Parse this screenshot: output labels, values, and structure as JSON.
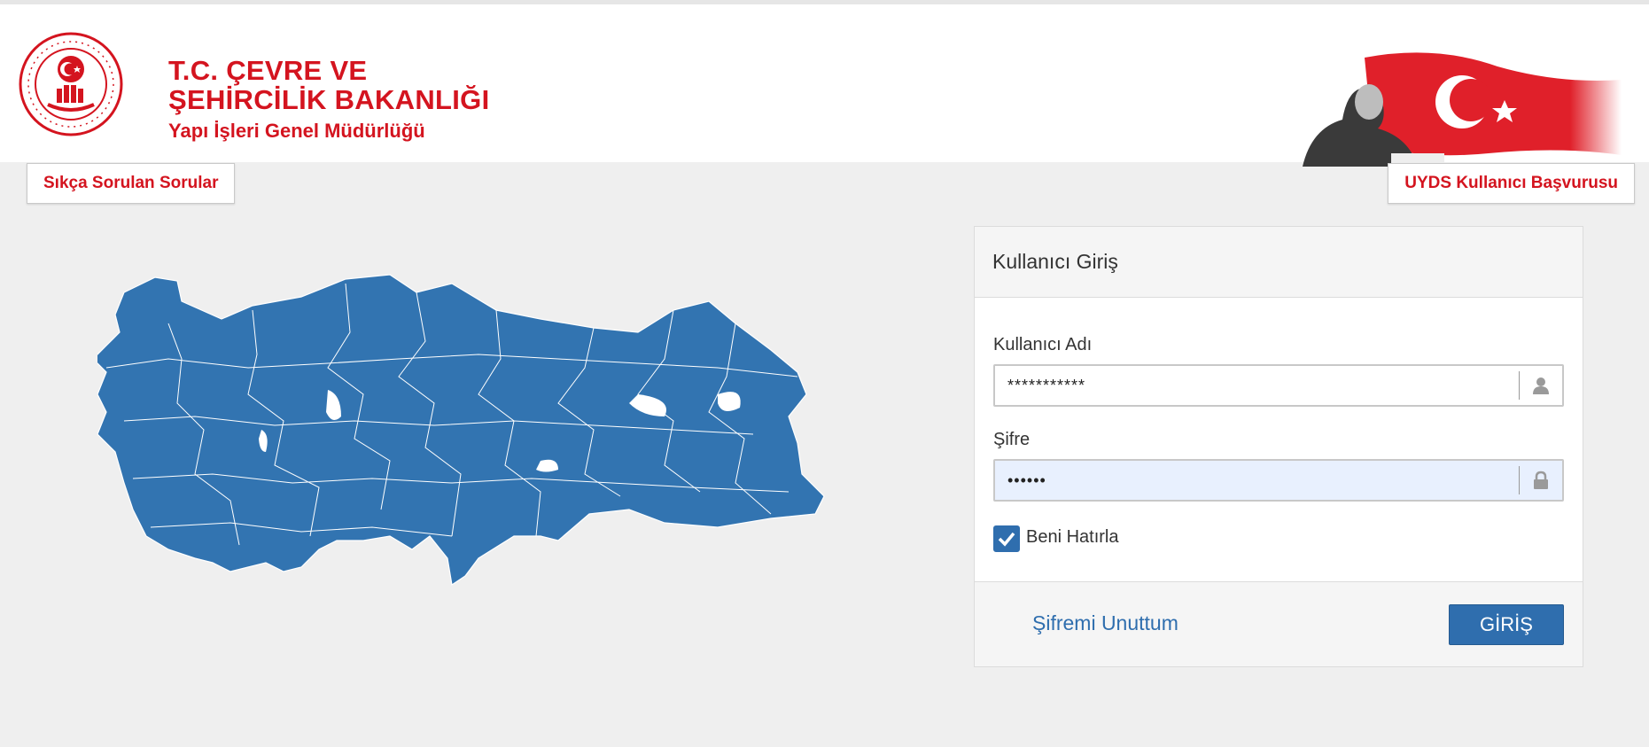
{
  "header": {
    "ministry_line1": "T.C. ÇEVRE VE",
    "ministry_line2": "ŞEHİRCİLİK BAKANLIĞI",
    "ministry_line3": "Yapı İşleri Genel Müdürlüğü"
  },
  "nav": {
    "faq_label": "Sıkça Sorulan Sorular",
    "apply_label": "UYDS Kullanıcı Başvurusu"
  },
  "login": {
    "title": "Kullanıcı Giriş",
    "username_label": "Kullanıcı Adı",
    "username_value": "***********",
    "password_label": "Şifre",
    "password_value": "••••••",
    "remember_label": "Beni Hatırla",
    "remember_checked": true,
    "forgot_label": "Şifremi Unuttum",
    "submit_label": "GİRİŞ"
  },
  "icons": {
    "username": "user-icon",
    "password": "lock-icon",
    "remember": "check-icon"
  },
  "colors": {
    "brand_red": "#d4141f",
    "map_blue": "#3274b1",
    "button_blue": "#2f6eae",
    "autofill_bg": "#e8f0fe"
  }
}
